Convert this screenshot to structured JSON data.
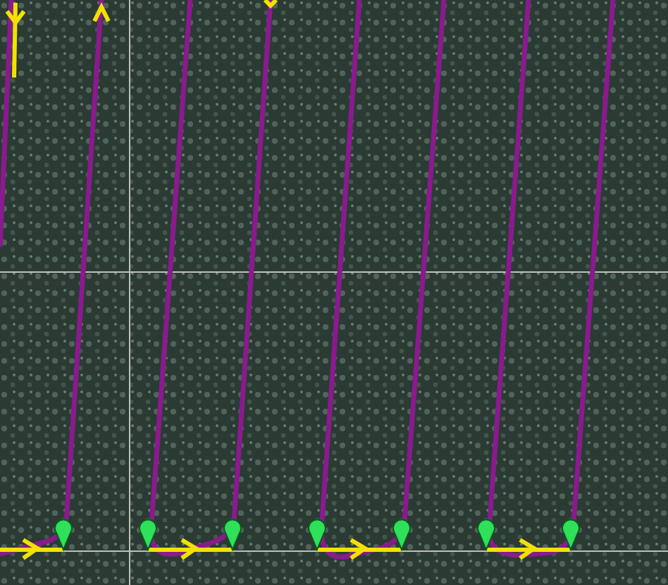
{
  "map": {
    "layers": [
      {
        "kind": "grid"
      },
      {
        "kind": "path"
      },
      {
        "kind": "legs"
      },
      {
        "kind": "waypoints"
      }
    ]
  }
}
